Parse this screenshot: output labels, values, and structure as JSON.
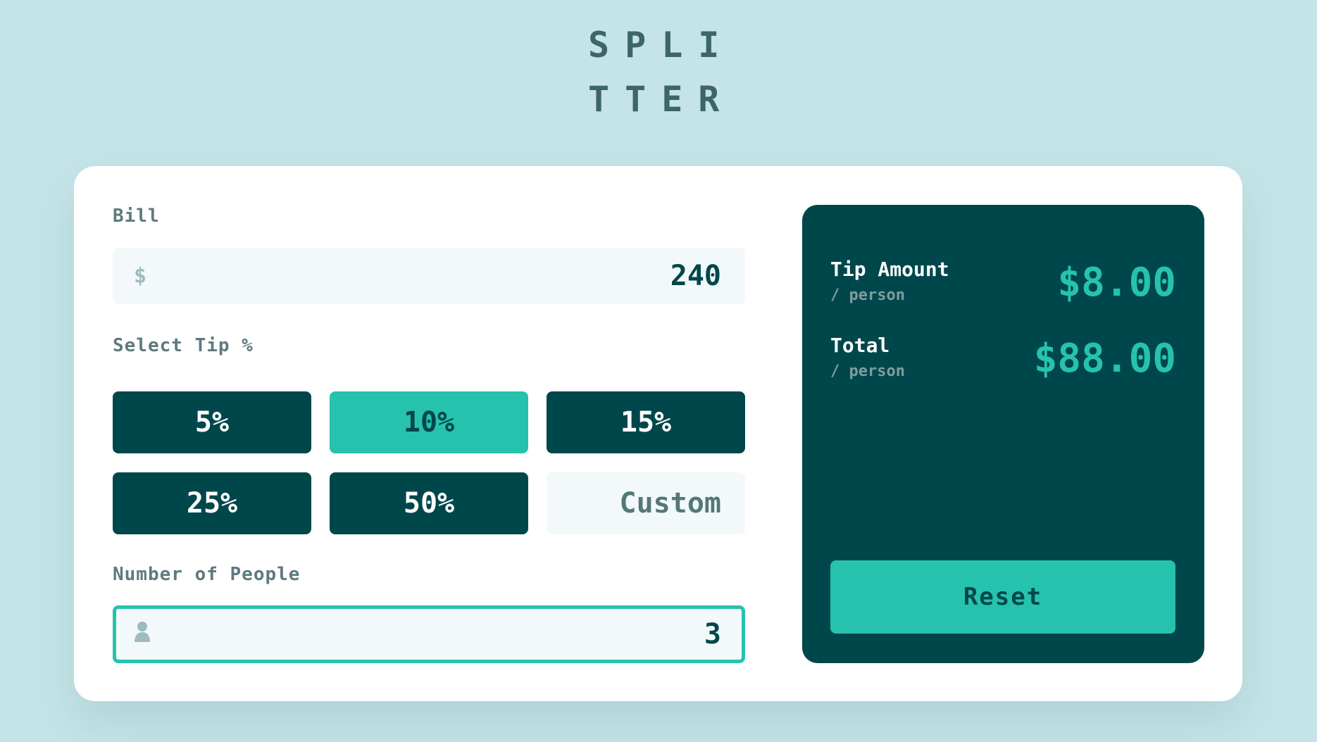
{
  "logo": {
    "line1": "SPLI",
    "line2": "TTER"
  },
  "bill": {
    "label": "Bill",
    "currency_icon": "$",
    "value": "240"
  },
  "tip": {
    "label": "Select Tip %",
    "options": [
      "5%",
      "10%",
      "15%",
      "25%",
      "50%"
    ],
    "selected": "10%",
    "custom_placeholder": "Custom"
  },
  "people": {
    "label": "Number of People",
    "icon": "person-icon",
    "value": "3"
  },
  "results": {
    "tip_amount": {
      "title": "Tip Amount",
      "sub": "/ person",
      "value": "$8.00"
    },
    "total": {
      "title": "Total",
      "sub": "/ person",
      "value": "$88.00"
    },
    "reset_label": "Reset"
  },
  "colors": {
    "background": "#c5e4e7",
    "dark_cyan": "#00474b",
    "strong_cyan": "#26c2ad",
    "input_bg": "#f3f9fa"
  }
}
